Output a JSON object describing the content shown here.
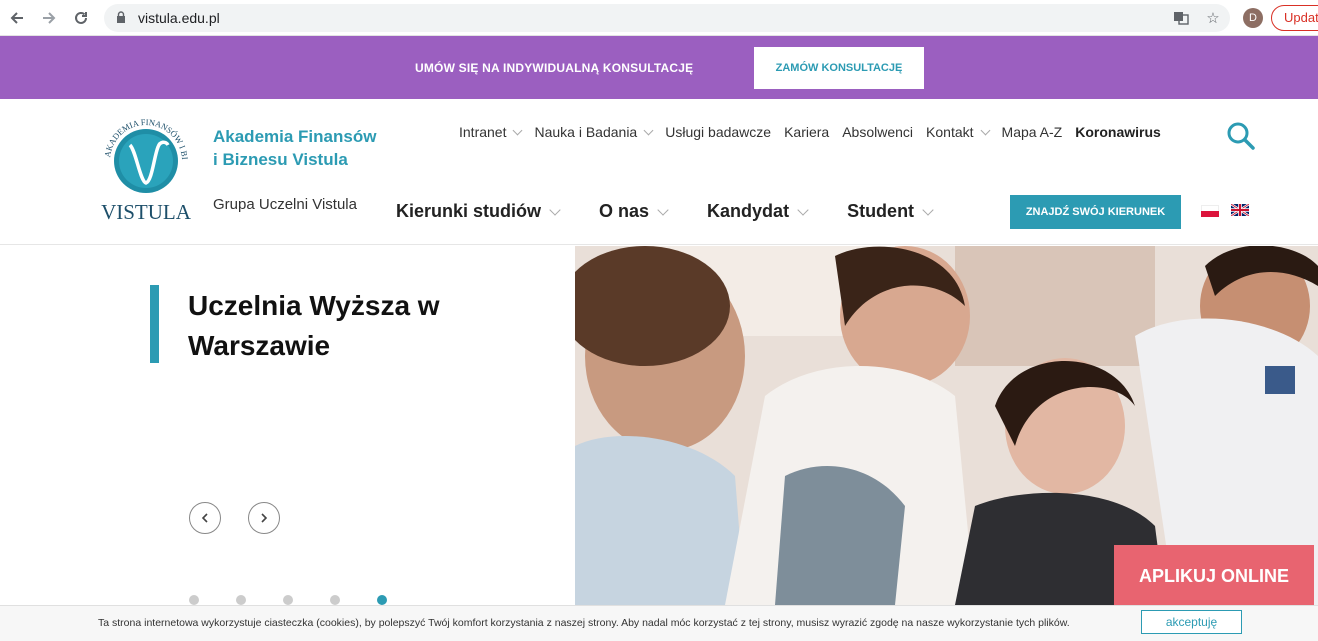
{
  "browser": {
    "url": "vistula.edu.pl",
    "profile_initial": "D",
    "update_label": "Update",
    "back_icon": "arrow-left-icon",
    "forward_icon": "arrow-right-icon",
    "reload_icon": "reload-icon"
  },
  "promo": {
    "text": "UMÓW SIĘ NA INDYWIDUALNĄ KONSULTACJĘ",
    "button": "ZAMÓW KONSULTACJĘ",
    "color": "#9b5fc0"
  },
  "brand": {
    "name": "Akademia Finansów i Biznesu Vistula",
    "subtitle": "Grupa Uczelni Vistula",
    "logo_text": "VISTULA",
    "logo_ring_text": "AKADEMIA FINANSÓW I BIZNESU",
    "accent": "#2c9bb3"
  },
  "top_nav": [
    {
      "label": "Intranet",
      "dropdown": true
    },
    {
      "label": "Nauka i Badania",
      "dropdown": true
    },
    {
      "label": "Usługi badawcze",
      "dropdown": false
    },
    {
      "label": "Kariera",
      "dropdown": false
    },
    {
      "label": "Absolwenci",
      "dropdown": false
    },
    {
      "label": "Kontakt",
      "dropdown": true
    },
    {
      "label": "Mapa A-Z",
      "dropdown": false
    },
    {
      "label": "Koronawirus",
      "dropdown": false
    }
  ],
  "main_nav": [
    {
      "label": "Kierunki studiów"
    },
    {
      "label": "O nas"
    },
    {
      "label": "Kandydat"
    },
    {
      "label": "Student"
    }
  ],
  "cta": "ZNAJDŹ SWÓJ KIERUNEK",
  "hero": {
    "title": "Uczelnia Wyższa w Warszawie",
    "prev_icon": "chevron-left-icon",
    "next_icon": "chevron-right-icon",
    "slide_count": 5,
    "active_slide": 5
  },
  "apply_button": "APLIKUJ ONLINE",
  "apply_color": "#e86470",
  "cookie": {
    "text": "Ta strona internetowa wykorzystuje ciasteczka (cookies), by polepszyć Twój komfort korzystania z naszej strony. Aby nadal móc korzystać z tej strony, musisz wyrazić zgodę na nasze wykorzystanie tych plików.",
    "button": "akceptuję"
  }
}
